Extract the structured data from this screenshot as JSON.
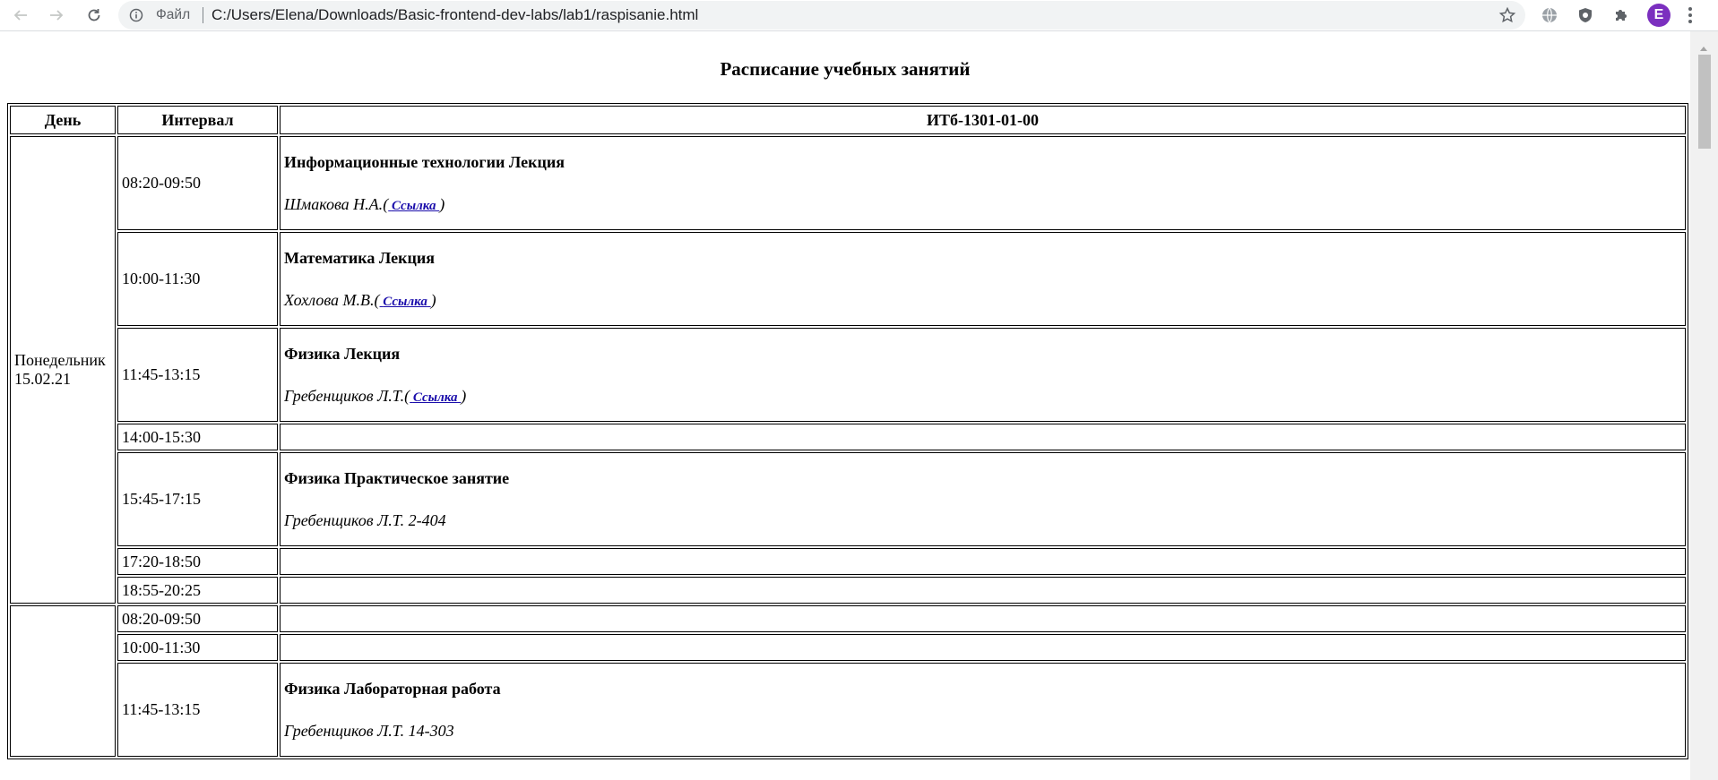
{
  "browser": {
    "scheme_label": "Файл",
    "url": "C:/Users/Elena/Downloads/Basic-frontend-dev-labs/lab1/raspisanie.html",
    "profile_initial": "E",
    "accent_color": "#7b2fbf"
  },
  "page": {
    "title": "Расписание учебных занятий",
    "headers": {
      "day": "День",
      "interval": "Интервал",
      "group": "ИТб-1301-01-00"
    },
    "days": [
      {
        "day_name": "Понедельник",
        "date": "15.02.21",
        "rows": [
          {
            "time": "08:20-09:50",
            "subject": "Информационные технологии Лекция",
            "teacher": "Шмакова Н.А.",
            "link": "Ссылка"
          },
          {
            "time": "10:00-11:30",
            "subject": "Математика Лекция",
            "teacher": "Хохлова М.В.",
            "link": "Ссылка"
          },
          {
            "time": "11:45-13:15",
            "subject": "Физика Лекция",
            "teacher": "Гребенщиков Л.Т.",
            "link": "Ссылка"
          },
          {
            "time": "14:00-15:30"
          },
          {
            "time": "15:45-17:15",
            "subject": "Физика Практическое занятие",
            "teacher": "Гребенщиков Л.Т. 2-404"
          },
          {
            "time": "17:20-18:50"
          },
          {
            "time": "18:55-20:25"
          }
        ]
      },
      {
        "rows": [
          {
            "time": "08:20-09:50"
          },
          {
            "time": "10:00-11:30"
          },
          {
            "time": "11:45-13:15",
            "subject": "Физика Лабораторная работа",
            "teacher": "Гребенщиков Л.Т. 14-303"
          }
        ]
      }
    ]
  }
}
